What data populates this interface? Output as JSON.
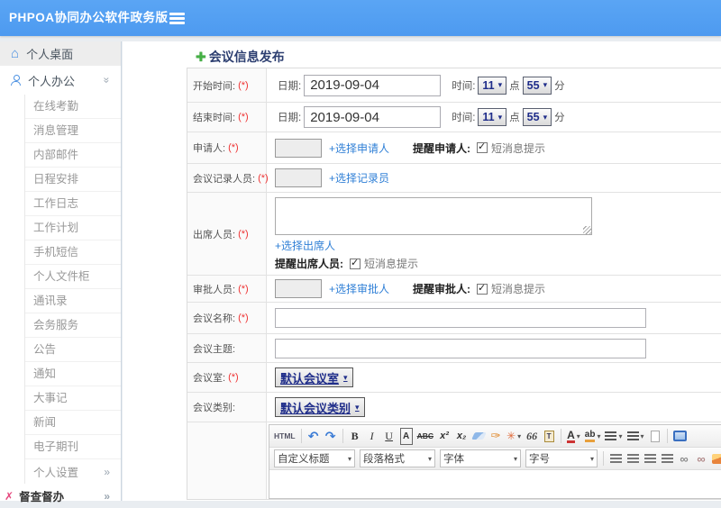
{
  "app": {
    "title": "PHPOA协同办公软件政务版"
  },
  "colors": {
    "header_blue": "#4d9af0",
    "accent_blue": "#4a90e2",
    "link_blue": "#2f7fd6",
    "navy": "#1f2d8a",
    "required_red": "#ee3333",
    "pink": "#e5477d",
    "green": "#45b045"
  },
  "sidebar": {
    "desktop_label": "个人桌面",
    "office_label": "个人办公",
    "office_items": [
      "在线考勤",
      "消息管理",
      "内部邮件",
      "日程安排",
      "工作日志",
      "工作计划",
      "手机短信",
      "个人文件柜",
      "通讯录",
      "会务服务",
      "公告",
      "通知",
      "大事记",
      "新闻",
      "电子期刊"
    ],
    "settings_label": "个人设置",
    "supervision_label": "督查督办"
  },
  "form": {
    "title": "会议信息发布",
    "required_mark": "(*)",
    "start_time": {
      "label": "开始时间:",
      "date_label": "日期:",
      "date_value": "2019-09-04",
      "time_label": "时间:",
      "hour": "11",
      "hour_unit": "点",
      "minute": "55",
      "minute_unit": "分"
    },
    "end_time": {
      "label": "结束时间:",
      "date_label": "日期:",
      "date_value": "2019-09-04",
      "time_label": "时间:",
      "hour": "11",
      "hour_unit": "点",
      "minute": "55",
      "minute_unit": "分"
    },
    "applicant": {
      "label": "申请人:",
      "link": "+选择申请人",
      "remind_label": "提醒申请人:",
      "sms_label": "短消息提示"
    },
    "recorder": {
      "label": "会议记录人员:",
      "link": "+选择记录员"
    },
    "attendees": {
      "label": "出席人员:",
      "link": "+选择出席人",
      "remind_label": "提醒出席人员:",
      "sms_label": "短消息提示"
    },
    "approver": {
      "label": "审批人员:",
      "link": "+选择审批人",
      "remind_label": "提醒审批人:",
      "sms_label": "短消息提示"
    },
    "meeting_name": {
      "label": "会议名称:"
    },
    "meeting_subject": {
      "label": "会议主题:"
    },
    "meeting_room": {
      "label": "会议室:",
      "value": "默认会议室"
    },
    "meeting_category": {
      "label": "会议类别:",
      "value": "默认会议类别"
    }
  },
  "editor": {
    "source_button": "HTML",
    "heading_select": "自定义标题",
    "paragraph_select": "段落格式",
    "font_select": "字体",
    "size_select": "字号",
    "icons": {
      "undo": "↶",
      "redo": "↷",
      "bold": "B",
      "italic": "I",
      "underline": "U",
      "font_box": "A",
      "strikethrough": "ABC",
      "superscript": "x²",
      "subscript": "x₂",
      "brush": "✑",
      "format_paint": "✳",
      "blockquote": "66",
      "font_color": "A",
      "highlight": "ab"
    }
  }
}
